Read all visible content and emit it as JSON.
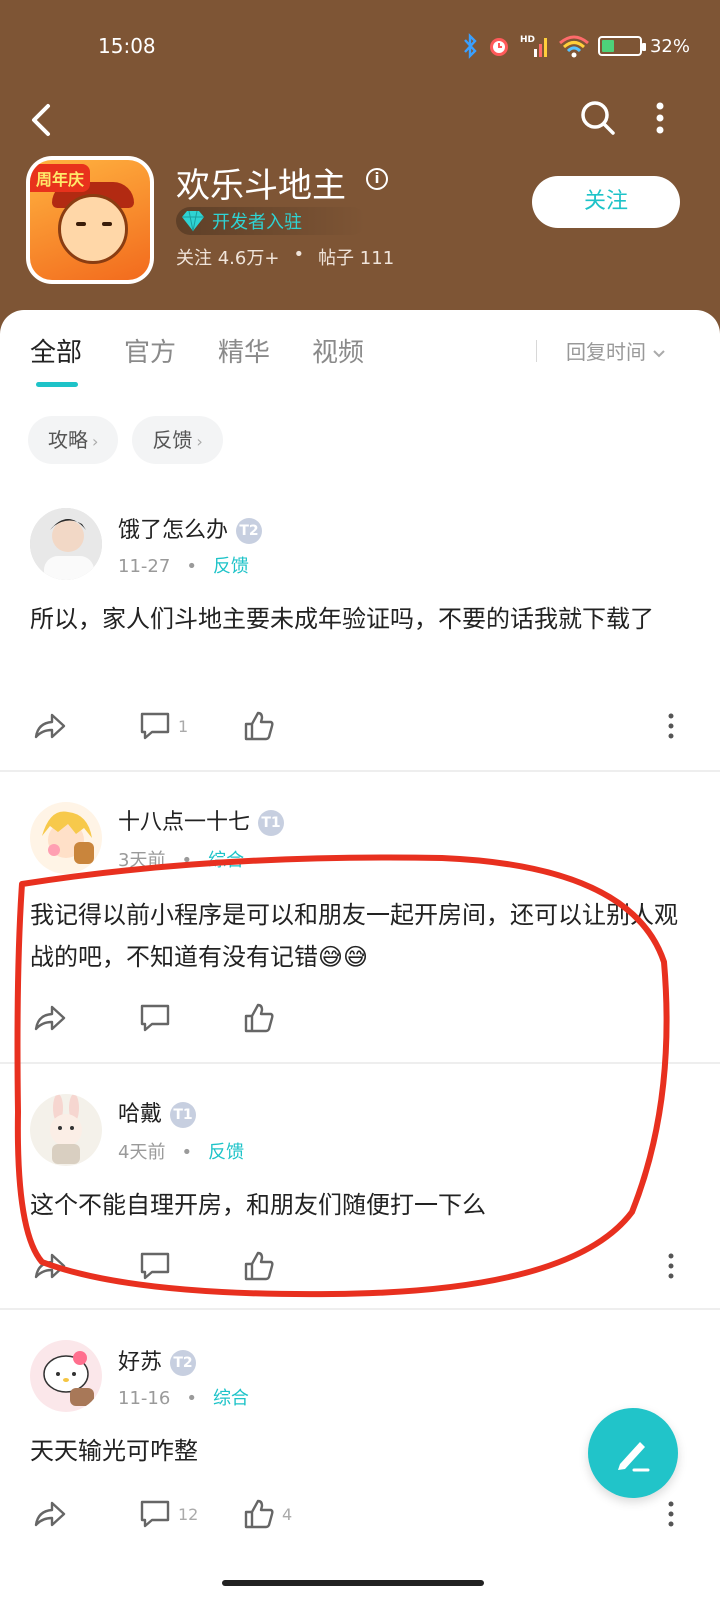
{
  "status_bar": {
    "time": "15:08",
    "battery": "32%",
    "battery_level": 0.32
  },
  "header": {
    "app_name": "欢乐斗地主",
    "info_symbol": "i",
    "anniversary_badge": "周年庆",
    "developer_badge": "开发者入驻",
    "followers": "关注 4.6万+",
    "separator": "•",
    "posts": "帖子 111",
    "follow_label": "关注"
  },
  "tabs": [
    {
      "label": "全部"
    },
    {
      "label": "官方"
    },
    {
      "label": "精华"
    },
    {
      "label": "视频"
    }
  ],
  "sort_label": "回复时间",
  "chips": [
    {
      "label": "攻略"
    },
    {
      "label": "反馈"
    }
  ],
  "posts": [
    {
      "user": "饿了怎么办",
      "level": "T2",
      "date": "11-27",
      "category": "反馈",
      "text": "所以，家人们斗地主要未成年验证吗，不要的话我就下载了",
      "comments": "1",
      "likes": ""
    },
    {
      "user": "十八点一十七",
      "level": "T1",
      "date": "3天前",
      "category": "综合",
      "text": "我记得以前小程序是可以和朋友一起开房间，还可以让别人观战的吧，不知道有没有记错😅😅",
      "comments": "",
      "likes": ""
    },
    {
      "user": "哈戴",
      "level": "T1",
      "date": "4天前",
      "category": "反馈",
      "text": "这个不能自理开房，和朋友们随便打一下么",
      "comments": "",
      "likes": ""
    },
    {
      "user": "好苏",
      "level": "T2",
      "date": "11-16",
      "category": "综合",
      "text": "天天输光可咋整",
      "comments": "12",
      "likes": "4"
    }
  ],
  "colors": {
    "header_bg": "#7e5535",
    "accent": "#1ec3c8",
    "annotation": "#e8301f"
  }
}
